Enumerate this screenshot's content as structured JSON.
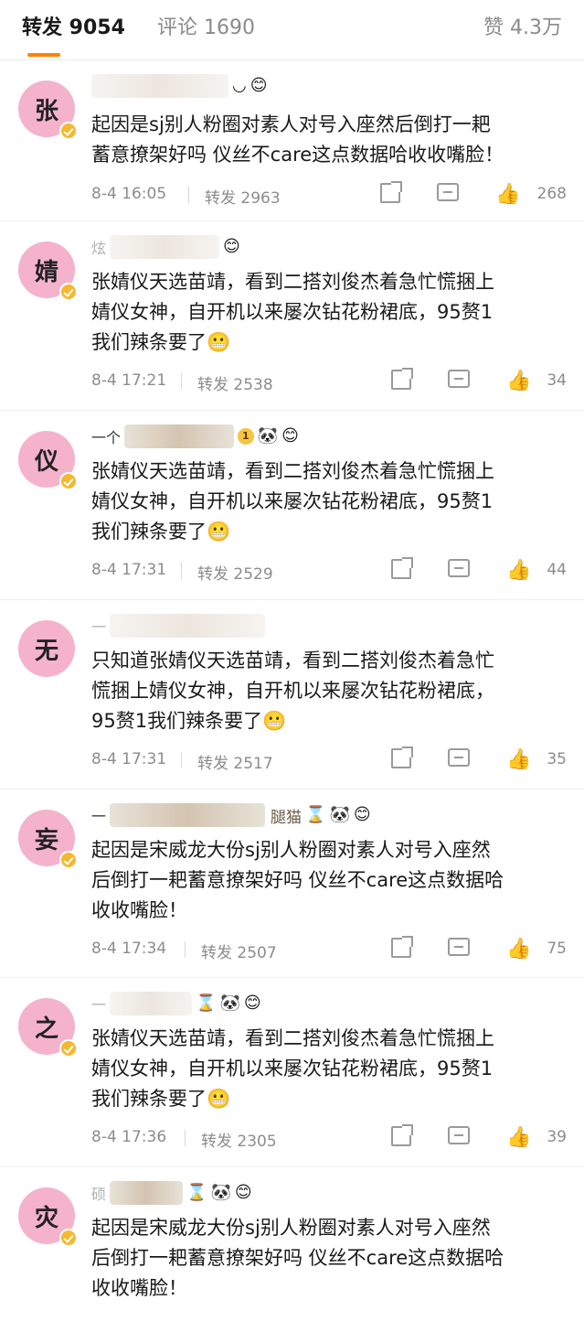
{
  "tabs": {
    "repost": "转发 9054",
    "comment": "评论 1690",
    "like": "赞 4.3万"
  },
  "colors": {
    "accent": "#ff8200",
    "avatar_bg": "#f4b3cb",
    "like_active": "#e8743b"
  },
  "comments": [
    {
      "avatar_char": "张",
      "name_icons": [
        "emoji-icon",
        "smiley-icon"
      ],
      "content": "起因是sj别人粉圈对素人对号入座然后倒打一耙\n蓄意撩架好吗 仪丝不care这点数据哈收收嘴脸！",
      "time": "8-4 16:05",
      "repost": "转发 2963",
      "likes": "268",
      "liked": false
    },
    {
      "avatar_char": "婧",
      "name_prefix": "炫",
      "content": "张婧仪天选苗靖，看到二搭刘俊杰着急忙慌捆上\n婧仪女神，自开机以来屡次钻花粉裙底，95赘1\n我们辣条要了😬",
      "time": "8-4 17:21",
      "repost": "转发 2538",
      "likes": "34",
      "liked": true
    },
    {
      "avatar_char": "仪",
      "name_prefix": "一个",
      "badge_text": "1",
      "content": "张婧仪天选苗靖，看到二搭刘俊杰着急忙慌捆上\n婧仪女神，自开机以来屡次钻花粉裙底，95赘1\n我们辣条要了😬",
      "time": "8-4 17:31",
      "repost": "转发 2529",
      "likes": "44",
      "liked": true
    },
    {
      "avatar_char": "无",
      "name_prefix": "一",
      "content": "只知道张婧仪天选苗靖，看到二搭刘俊杰着急忙\n慌捆上婧仪女神，自开机以来屡次钻花粉裙底，\n95赘1我们辣条要了😬",
      "time": "8-4 17:31",
      "repost": "转发 2517",
      "likes": "35",
      "liked": true
    },
    {
      "avatar_char": "妄",
      "name_prefix": "一",
      "name_suffix": "腿猫",
      "content": "起因是宋威龙大份sj别人粉圈对素人对号入座然\n后倒打一耙蓄意撩架好吗 仪丝不care这点数据哈\n收收嘴脸！",
      "time": "8-4 17:34",
      "repost": "转发 2507",
      "likes": "75",
      "liked": true
    },
    {
      "avatar_char": "之",
      "name_prefix": "一",
      "content": "张婧仪天选苗靖，看到二搭刘俊杰着急忙慌捆上\n婧仪女神，自开机以来屡次钻花粉裙底，95赘1\n我们辣条要了😬",
      "time": "8-4 17:36",
      "repost": "转发 2305",
      "likes": "39",
      "liked": true
    },
    {
      "avatar_char": "灾",
      "name_prefix": "硕",
      "content": "起因是宋威龙大份sj别人粉圈对素人对号入座然\n后倒打一耙蓄意撩架好吗 仪丝不care这点数据哈\n收收嘴脸！"
    }
  ]
}
